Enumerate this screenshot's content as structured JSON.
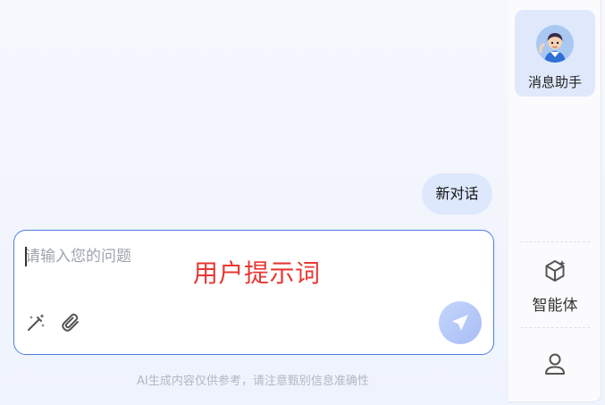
{
  "sidebar": {
    "assistant": {
      "label": "消息助手",
      "icon": "assistant-avatar"
    },
    "agents": {
      "label": "智能体",
      "icon": "cube-sparkle-icon"
    },
    "user": {
      "icon": "user-icon"
    }
  },
  "chat": {
    "new_chat_label": "新对话"
  },
  "input": {
    "placeholder": "请输入您的问题",
    "value": "",
    "annotation": "用户提示词",
    "tools": [
      "magic-wand-icon",
      "paperclip-icon"
    ],
    "send_icon": "send-icon"
  },
  "footer": {
    "disclaimer": "AI生成内容仅供参考，请注意甄别信息准确性"
  },
  "colors": {
    "accent_border": "#4d7de6",
    "annotation": "#e53935",
    "bubble_bg": "#dde8fd",
    "assistant_card_bg": "#dfe9fb"
  }
}
